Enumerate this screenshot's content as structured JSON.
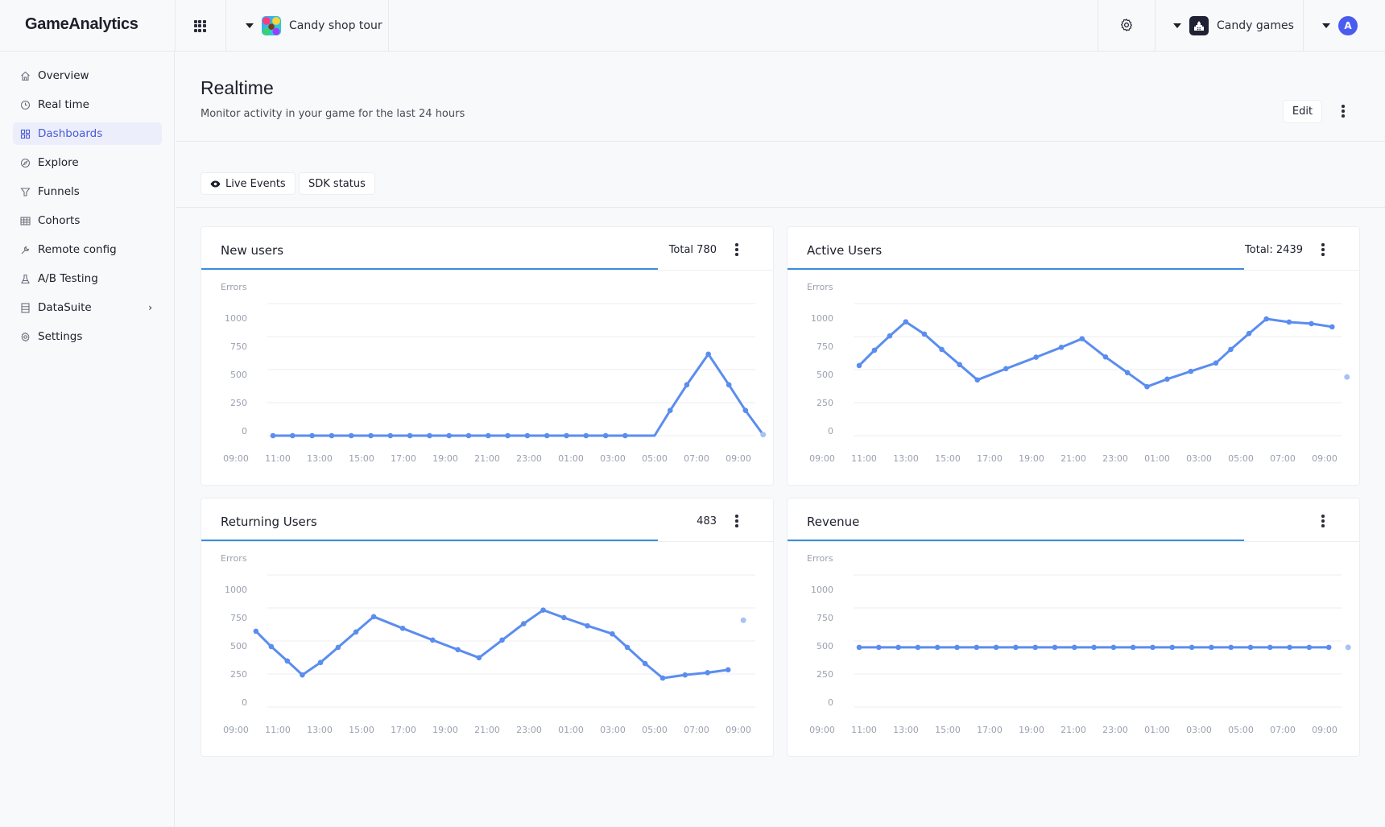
{
  "app": {
    "logo": "GameAnalytics",
    "game_name": "Candy shop tour",
    "org_name": "Candy games",
    "avatar_initial": "A",
    "accent_color": "#4a5bd6",
    "line_color": "#5b8def"
  },
  "sidebar": {
    "items": [
      {
        "label": "Overview",
        "icon": "home-icon",
        "active": false
      },
      {
        "label": "Real time",
        "icon": "clock-icon",
        "active": false
      },
      {
        "label": "Dashboards",
        "icon": "dashboard-grid-icon",
        "active": true
      },
      {
        "label": "Explore",
        "icon": "compass-icon",
        "active": false
      },
      {
        "label": "Funnels",
        "icon": "funnel-icon",
        "active": false
      },
      {
        "label": "Cohorts",
        "icon": "table-icon",
        "active": false
      },
      {
        "label": "Remote config",
        "icon": "wrench-icon",
        "active": false
      },
      {
        "label": "A/B Testing",
        "icon": "flask-icon",
        "active": false
      },
      {
        "label": "DataSuite",
        "icon": "database-icon",
        "active": false,
        "has_submenu": true
      },
      {
        "label": "Settings",
        "icon": "gear-icon",
        "active": false
      }
    ]
  },
  "page": {
    "title": "Realtime",
    "subtitle": "Monitor activity in your game for the last 24 hours",
    "edit_label": "Edit",
    "buttons": {
      "live_events": "Live Events",
      "sdk_status": "SDK status"
    }
  },
  "chart_data": [
    {
      "type": "line",
      "title": "New users",
      "total_label": "Total 780",
      "ylabel": "Errors",
      "ylim": [
        0,
        1000
      ],
      "yticks": [
        "1000",
        "750",
        "500",
        "250",
        "0"
      ],
      "xticks": [
        "09:00",
        "11:00",
        "13:00",
        "15:00",
        "17:00",
        "19:00",
        "21:00",
        "23:00",
        "01:00",
        "03:00",
        "05:00",
        "07:00",
        "09:00"
      ],
      "grid": true,
      "values": [
        0,
        0,
        0,
        0,
        0,
        0,
        0,
        0,
        0,
        0,
        0,
        0,
        0,
        0,
        0,
        0,
        0,
        0,
        0,
        0,
        191,
        385,
        617,
        385,
        191
      ],
      "value_indices": [
        0,
        1,
        2,
        3,
        4,
        5,
        6,
        7,
        8,
        9,
        10,
        11,
        12,
        13,
        14,
        15,
        16,
        17,
        18,
        19.5,
        20.3,
        21.15,
        22.25,
        23.3,
        24.15
      ],
      "pending_point": {
        "index": 25.05,
        "value": 8
      }
    },
    {
      "type": "line",
      "title": "Active Users",
      "total_label": "Total: 2439",
      "ylabel": "Errors",
      "ylim": [
        0,
        1000
      ],
      "yticks": [
        "1000",
        "750",
        "500",
        "250",
        "0"
      ],
      "xticks": [
        "09:00",
        "11:00",
        "13:00",
        "15:00",
        "17:00",
        "19:00",
        "21:00",
        "23:00",
        "01:00",
        "03:00",
        "05:00",
        "07:00",
        "09:00"
      ],
      "grid": true,
      "values": [
        531,
        647,
        755,
        862,
        769,
        653,
        538,
        422,
        507,
        594,
        669,
        734,
        596,
        477,
        371,
        428,
        487,
        550,
        653,
        773,
        884,
        860,
        848,
        824
      ],
      "value_indices": [
        0,
        0.78,
        1.56,
        2.38,
        3.33,
        4.22,
        5.13,
        6.04,
        7.5,
        9.04,
        10.33,
        11.39,
        12.59,
        13.71,
        14.71,
        15.74,
        16.95,
        18.23,
        18.99,
        19.92,
        20.81,
        21.97,
        23.11,
        24.17
      ],
      "pending_point": {
        "index": 24.93,
        "value": 444
      }
    },
    {
      "type": "line",
      "title": "Returning Users",
      "total_label": "483",
      "ylabel": "Errors",
      "ylim": [
        0,
        1000
      ],
      "yticks": [
        "1000",
        "750",
        "500",
        "250",
        "0"
      ],
      "xticks": [
        "09:00",
        "11:00",
        "13:00",
        "15:00",
        "17:00",
        "19:00",
        "21:00",
        "23:00",
        "01:00",
        "03:00",
        "05:00",
        "07:00",
        "09:00"
      ],
      "grid": true,
      "values": [
        574,
        458,
        349,
        243,
        337,
        452,
        568,
        684,
        596,
        507,
        434,
        373,
        507,
        631,
        734,
        677,
        615,
        554,
        452,
        329,
        219,
        243,
        260,
        282
      ],
      "value_indices": [
        -0.87,
        -0.09,
        0.73,
        1.5,
        2.43,
        3.33,
        4.24,
        5.15,
        6.63,
        8.16,
        9.45,
        10.53,
        11.71,
        12.81,
        13.81,
        14.87,
        16.07,
        17.34,
        18.11,
        19.02,
        19.92,
        21.06,
        22.21,
        23.26
      ],
      "pending_point": {
        "index": 24.04,
        "value": 657
      }
    },
    {
      "type": "line",
      "title": "Revenue",
      "total_label": "",
      "ylabel": "Errors",
      "ylim": [
        0,
        1000
      ],
      "yticks": [
        "1000",
        "750",
        "500",
        "250",
        "0"
      ],
      "xticks": [
        "09:00",
        "11:00",
        "13:00",
        "15:00",
        "17:00",
        "19:00",
        "21:00",
        "23:00",
        "01:00",
        "03:00",
        "05:00",
        "07:00",
        "09:00"
      ],
      "grid": true,
      "values": [
        452,
        452,
        452,
        452,
        452,
        452,
        452,
        452,
        452,
        452,
        452,
        452,
        452,
        452,
        452,
        452,
        452,
        452,
        452,
        452,
        452,
        452,
        452,
        452,
        452
      ],
      "value_indices": [
        0,
        1,
        2,
        3,
        4,
        5,
        6,
        7,
        8,
        9,
        10,
        11,
        12,
        13,
        14,
        15,
        16,
        17,
        18,
        19,
        20,
        21,
        22,
        23,
        24
      ],
      "pending_point": {
        "index": 24.99,
        "value": 452
      }
    }
  ]
}
